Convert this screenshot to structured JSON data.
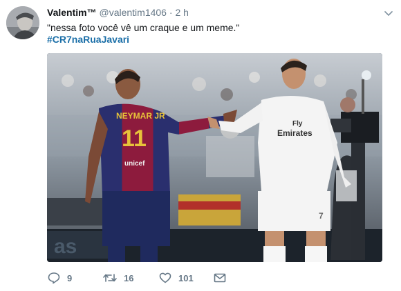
{
  "tweet": {
    "display_name": "Valentim™",
    "handle": "@valentim1406",
    "separator": "·",
    "time": "2 h",
    "text": "\"nessa foto você vê um craque e um meme.\"",
    "hashtag": "#CR7naRuaJavari"
  },
  "media": {
    "left_jersey_name": "NEYMAR JR",
    "left_jersey_number": "11",
    "left_jersey_sponsor": "unicef",
    "right_jersey_sponsor_line1": "Fly",
    "right_jersey_sponsor_line2": "Emirates",
    "right_shorts_number": "7"
  },
  "actions": {
    "reply_count": "9",
    "retweet_count": "16",
    "like_count": "101"
  },
  "icons": {
    "caret": "chevron-down-icon",
    "reply": "reply-icon",
    "retweet": "retweet-icon",
    "like": "heart-icon",
    "dm": "envelope-icon"
  },
  "colors": {
    "name": "#14171a",
    "muted": "#657786",
    "hashtag": "#1b6fa8",
    "background": "#ffffff"
  }
}
